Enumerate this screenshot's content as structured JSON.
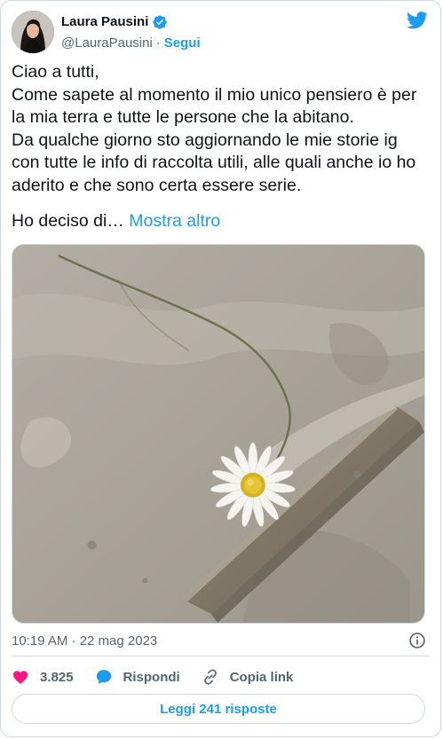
{
  "header": {
    "display_name": "Laura Pausini",
    "handle": "@LauraPausini",
    "separator": "·",
    "follow_label": "Segui"
  },
  "tweet": {
    "text": "Ciao a tutti,\nCome sapete al momento il mio unico pensiero è per la mia terra e tutte le persone che la abitano.\nDa qualche giorno sto aggiornando le mie storie ig con tutte le info di raccolta utili, alle quali anche io ho aderito e che sono certa essere serie.",
    "truncated_text": "Ho deciso di…",
    "show_more_label": "Mostra altro"
  },
  "media": {
    "description_icon": "photo-daisy-in-mud"
  },
  "meta": {
    "timestamp": "10:19 AM · 22 mag 2023"
  },
  "actions": {
    "likes_count": "3.825",
    "reply_label": "Rispondi",
    "copy_link_label": "Copia link"
  },
  "footer": {
    "read_replies_label": "Leggi 241 risposte"
  },
  "colors": {
    "accent": "#1d9bf0",
    "like": "#f91880",
    "text": "#0f1419",
    "secondary": "#536471",
    "border": "#cfd9de"
  },
  "icons": [
    "avatar",
    "verified-badge-icon",
    "twitter-bird-icon",
    "info-icon",
    "heart-icon",
    "reply-bubble-icon",
    "link-icon"
  ]
}
